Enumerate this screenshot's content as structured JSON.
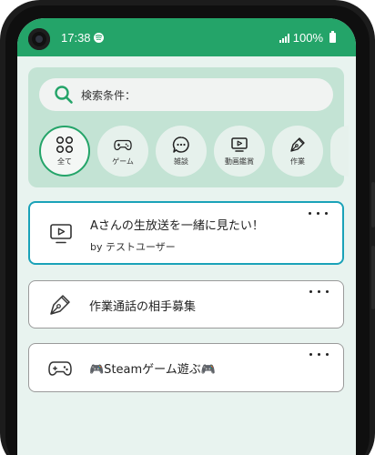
{
  "status_bar": {
    "time": "17:38",
    "battery": "100%"
  },
  "search": {
    "label": "検索条件："
  },
  "categories": [
    {
      "label": "全て",
      "icon": "grid-circles-icon",
      "active": true
    },
    {
      "label": "ゲーム",
      "icon": "gamepad-icon",
      "active": false
    },
    {
      "label": "雑談",
      "icon": "chat-bubble-icon",
      "active": false
    },
    {
      "label": "動画鑑賞",
      "icon": "video-screen-icon",
      "active": false
    },
    {
      "label": "作業",
      "icon": "pen-icon",
      "active": false
    }
  ],
  "rooms": [
    {
      "title": "Aさんの生放送を一緒に見たい！",
      "subtitle": "by テストユーザー",
      "icon": "video-screen-icon"
    },
    {
      "title": "作業通話の相手募集",
      "subtitle": "",
      "icon": "pen-icon"
    },
    {
      "title": "🎮Steamゲーム遊ぶ🎮",
      "subtitle": "",
      "icon": "gamepad-icon"
    }
  ],
  "colors": {
    "accent": "#24a469",
    "panel": "#c3e3d4",
    "background": "#e8f3ef",
    "selected_border": "#1aa2b8"
  }
}
